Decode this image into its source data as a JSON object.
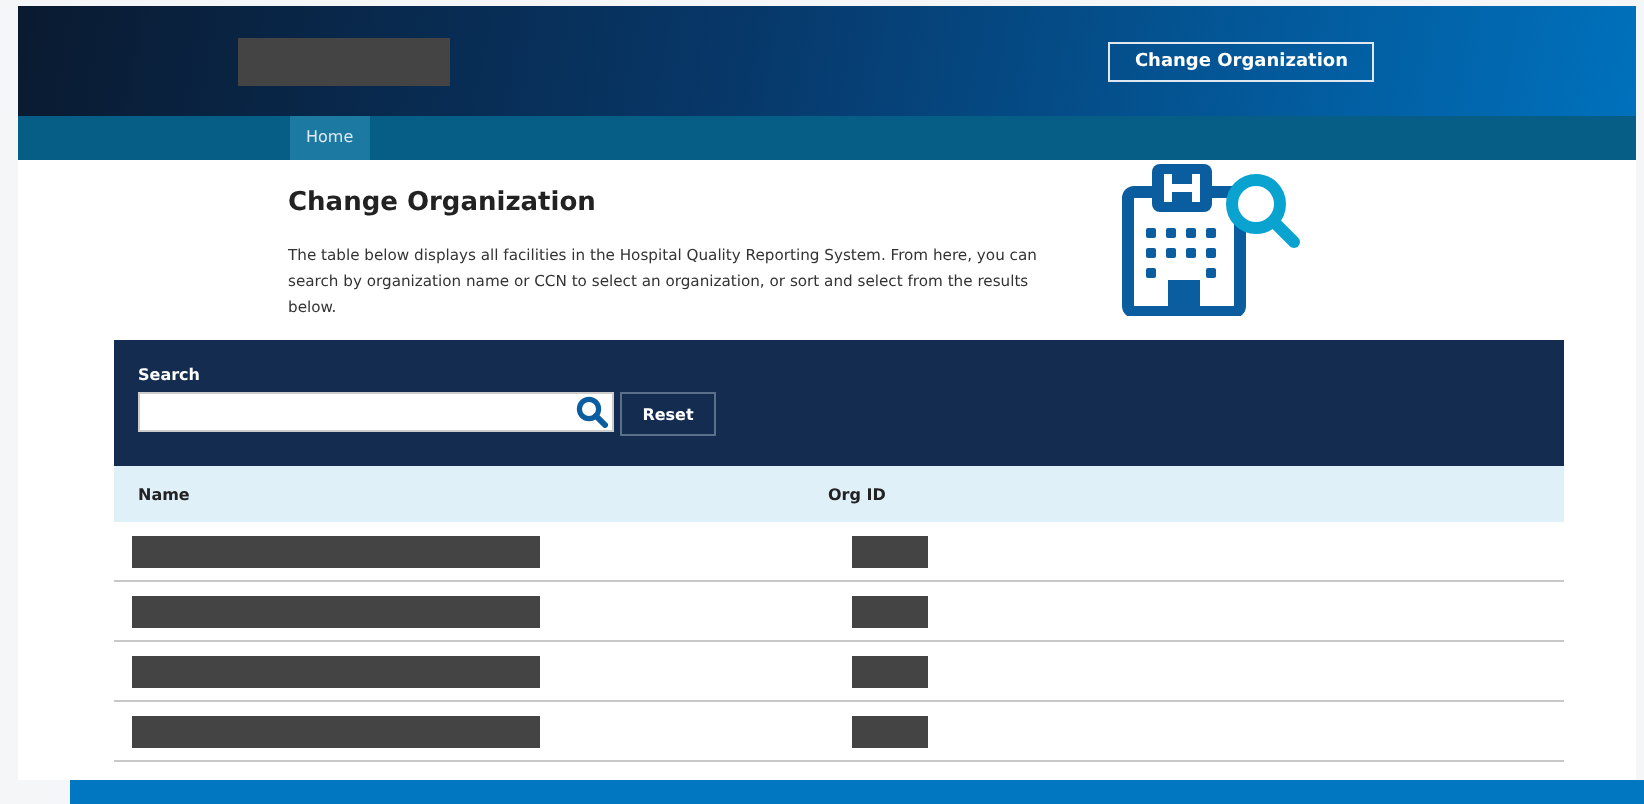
{
  "header": {
    "logo": {
      "kind": "redacted"
    },
    "button": "Change Organization"
  },
  "nav": [
    {
      "label": "Home",
      "selected": true
    }
  ],
  "intro": {
    "title": "Change Organization",
    "text": "The table below displays all facilities in the Hospital Quality Reporting System. From here, you can search by organization name or CCN to select an organization, or sort and select from the results below."
  },
  "search": {
    "label": "Search",
    "button": "Reset"
  },
  "table": {
    "columns": [
      "Name",
      "Org ID"
    ],
    "rows": [
      {
        "kind": "redacted"
      },
      {
        "kind": "redacted"
      },
      {
        "kind": "redacted"
      },
      {
        "kind": "redacted"
      }
    ]
  }
}
